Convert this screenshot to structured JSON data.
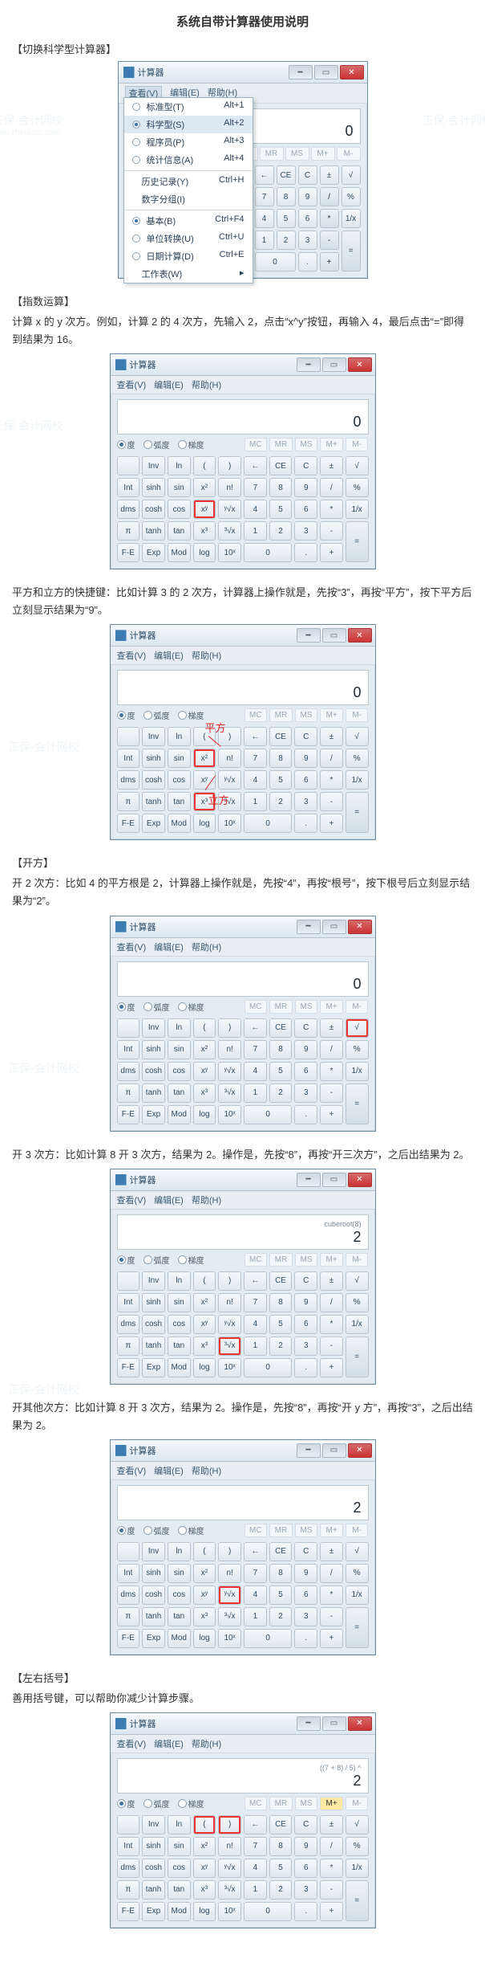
{
  "doc": {
    "title": "系统自带计算器使用说明",
    "sections": {
      "s1_header": "【切换科学型计算器】",
      "s2_header": "【指数运算】",
      "s2_text": "计算 x 的 y 次方。例如，计算 2 的 4 次方，先输入 2，点击“x^y”按钮，再输入 4，最后点击“=”即得到结果为 16。",
      "s2b_text": "平方和立方的快捷键：比如计算 3 的 2 次方，计算器上操作就是，先按“3”，再按“平方”，按下平方后立刻显示结果为“9”。",
      "s3_header": "【开方】",
      "s3_text": "开 2 次方：比如 4 的平方根是 2，计算器上操作就是，先按“4”，再按“根号”，按下根号后立刻显示结果为“2”。",
      "s3b_text": "开 3 次方：比如计算 8 开 3 次方，结果为 2。操作是，先按“8”，再按“开三次方”，之后出结果为 2。",
      "s3c_text": "开其他次方：比如计算 8 开 3 次方，结果为 2。操作是，先按“8”，再按“开 y 方”，再按“3”，之后出结果为 2。",
      "s4_header": "【左右括号】",
      "s4_text": "善用括号键，可以帮助你减少计算步骤。"
    }
  },
  "win": {
    "title": "计算器",
    "menu_view": "查看(V)",
    "menu_edit": "编辑(E)",
    "menu_help": "帮助(H)"
  },
  "dropdown": {
    "items": [
      {
        "label": "标准型(T)",
        "shortcut": "Alt+1",
        "radio": false
      },
      {
        "label": "科学型(S)",
        "shortcut": "Alt+2",
        "radio": true
      },
      {
        "label": "程序员(P)",
        "shortcut": "Alt+3",
        "radio": false
      },
      {
        "label": "统计信息(A)",
        "shortcut": "Alt+4",
        "radio": false
      },
      {
        "sep": true
      },
      {
        "label": "历史记录(Y)",
        "shortcut": "Ctrl+H",
        "radio": false
      },
      {
        "label": "数字分组(I)",
        "shortcut": "",
        "radio": false
      },
      {
        "sep": true
      },
      {
        "label": "基本(B)",
        "shortcut": "Ctrl+F4",
        "radio": true
      },
      {
        "label": "单位转换(U)",
        "shortcut": "Ctrl+U",
        "radio": false
      },
      {
        "label": "日期计算(D)",
        "shortcut": "Ctrl+E",
        "radio": false
      },
      {
        "label": "工作表(W)",
        "shortcut": "▸",
        "radio": false
      }
    ]
  },
  "mode": {
    "opt1": "度",
    "opt2": "弧度",
    "opt3": "梯度"
  },
  "mem": {
    "mc": "MC",
    "mr": "MR",
    "ms": "MS",
    "mp": "M+",
    "mm": "M-"
  },
  "keys": {
    "r1": [
      "",
      "Inv",
      "ln",
      "(",
      ")",
      "←",
      "CE",
      "C",
      "±",
      "√"
    ],
    "r2": [
      "Int",
      "sinh",
      "sin",
      "x²",
      "n!",
      "7",
      "8",
      "9",
      "/",
      "%"
    ],
    "r3": [
      "dms",
      "cosh",
      "cos",
      "xʸ",
      "ʸ√x",
      "4",
      "5",
      "6",
      "*",
      "1/x"
    ],
    "r4": [
      "π",
      "tanh",
      "tan",
      "x³",
      "³√x",
      "1",
      "2",
      "3",
      "-",
      "="
    ],
    "r5": [
      "F-E",
      "Exp",
      "Mod",
      "log",
      "10ˣ",
      "0",
      "",
      ".",
      "+",
      ""
    ]
  },
  "display": {
    "zero": "0",
    "cuberoot_label": "cuberoot(8)",
    "cuberoot_val": "2",
    "paren_expr": "((7 + 8) / 5) ^",
    "paren_val": "2"
  },
  "anno": {
    "square": "平方",
    "cube": "立方"
  },
  "watermark": {
    "brand": "正保·会计网校",
    "url": "www.chinaacc.com"
  }
}
